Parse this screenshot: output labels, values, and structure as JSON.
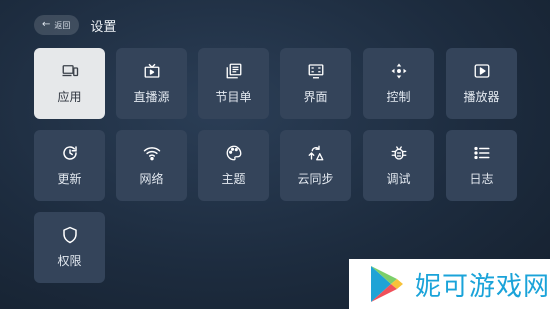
{
  "header": {
    "back_label": "返回",
    "title": "设置"
  },
  "tiles": [
    {
      "label": "应用",
      "icon": "devices-icon",
      "active": true
    },
    {
      "label": "直播源",
      "icon": "tv-icon",
      "active": false
    },
    {
      "label": "节目单",
      "icon": "library-icon",
      "active": false
    },
    {
      "label": "界面",
      "icon": "screen-icon",
      "active": false
    },
    {
      "label": "控制",
      "icon": "dpad-icon",
      "active": false
    },
    {
      "label": "播放器",
      "icon": "play-icon",
      "active": false
    },
    {
      "label": "更新",
      "icon": "update-icon",
      "active": false
    },
    {
      "label": "网络",
      "icon": "wifi-icon",
      "active": false
    },
    {
      "label": "主题",
      "icon": "palette-icon",
      "active": false
    },
    {
      "label": "云同步",
      "icon": "cloud-sync-icon",
      "active": false
    },
    {
      "label": "调试",
      "icon": "bug-icon",
      "active": false
    },
    {
      "label": "日志",
      "icon": "list-icon",
      "active": false
    },
    {
      "label": "权限",
      "icon": "shield-icon",
      "active": false
    }
  ],
  "watermark": {
    "text": "妮可游戏网"
  },
  "colors": {
    "background": "#1d2c3f",
    "tile": "#34445a",
    "tile_active": "#e6e8ea",
    "icon": "#ffffff",
    "icon_active": "#3a4049",
    "watermark_text": "#1aa3d9"
  }
}
